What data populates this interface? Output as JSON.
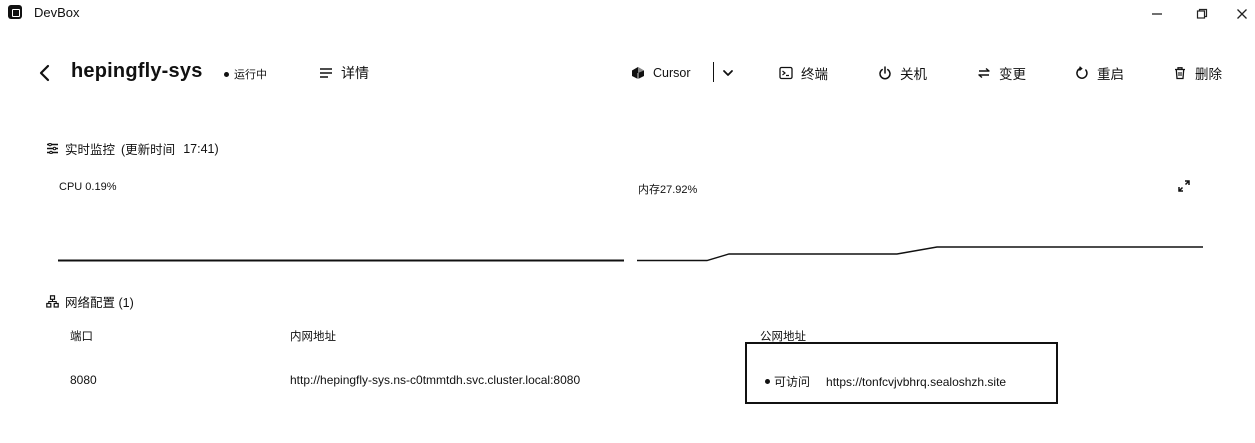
{
  "window": {
    "title": "DevBox"
  },
  "header": {
    "project_name": "hepingfly-sys",
    "status": "运行中",
    "detail_label": "详情",
    "ide_label": "Cursor",
    "actions": {
      "terminal": "终端",
      "shutdown": "关机",
      "change": "变更",
      "restart": "重启",
      "delete": "删除"
    }
  },
  "monitor": {
    "title": "实时监控",
    "update_label": "(更新时间",
    "update_time": "17:41)",
    "cpu_label": "CPU 0.19%",
    "memory_label": "内存27.92%"
  },
  "network": {
    "title": "网络配置 (1)",
    "columns": {
      "port": "端口",
      "internal": "内网地址",
      "public": "公网地址"
    },
    "rows": [
      {
        "port": "8080",
        "internal": "http://hepingfly-sys.ns-c0tmmtdh.svc.cluster.local:8080",
        "public_status": "可访问",
        "public_url": "https://tonfcvjvbhrq.sealoshzh.site"
      }
    ]
  }
}
